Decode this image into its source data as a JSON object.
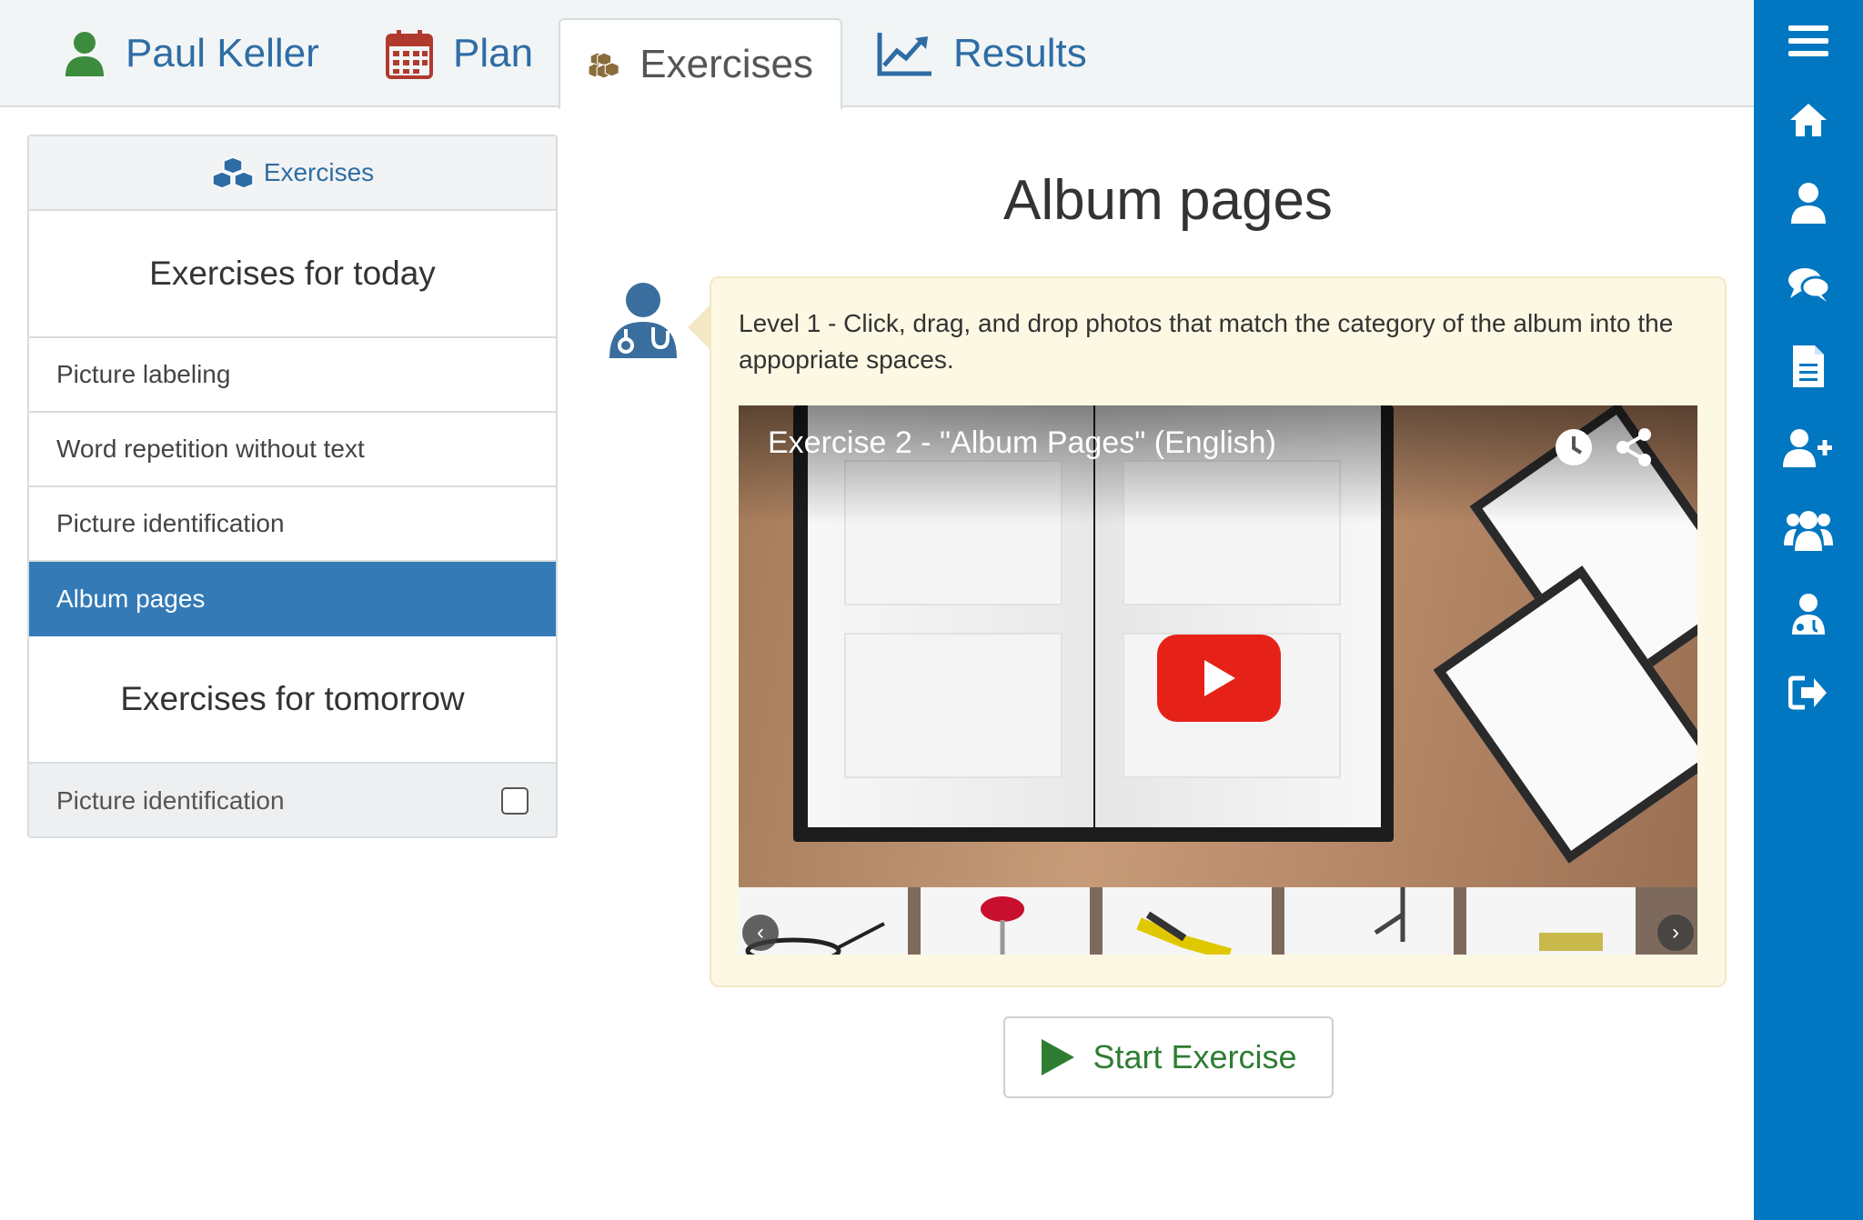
{
  "tabs": [
    {
      "label": "Paul Keller",
      "icon": "user-icon"
    },
    {
      "label": "Plan",
      "icon": "calendar-icon"
    },
    {
      "label": "Exercises",
      "icon": "cubes-icon"
    },
    {
      "label": "Results",
      "icon": "line-chart-icon"
    }
  ],
  "active_tab": "Exercises",
  "sidebar_icons": [
    "menu-icon",
    "home-icon",
    "user-icon",
    "chat-icon",
    "document-icon",
    "add-user-icon",
    "group-icon",
    "doctor-icon",
    "logout-icon"
  ],
  "panel": {
    "header": "Exercises",
    "today_title": "Exercises for today",
    "today_items": [
      "Picture labeling",
      "Word repetition without text",
      "Picture identification",
      "Album pages"
    ],
    "selected_item": "Album pages",
    "tomorrow_title": "Exercises for tomorrow",
    "tomorrow_items": [
      {
        "label": "Picture identification",
        "checked": false
      }
    ]
  },
  "main": {
    "title": "Album pages",
    "instruction": "Level 1 - Click, drag, and drop photos that match the category of the album into the appopriate spaces.",
    "video_title": "Exercise 2 - \"Album Pages\" (English)",
    "start_button": "Start Exercise"
  },
  "colors": {
    "sidebar": "#0077c0",
    "selected": "#337ab7",
    "link": "#2e6da4",
    "start": "#2e7d32",
    "bubble": "#fcf8e3"
  }
}
